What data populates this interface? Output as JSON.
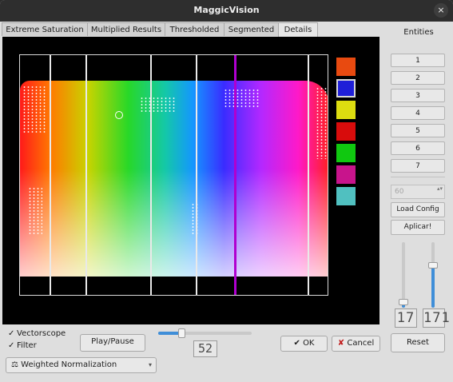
{
  "window": {
    "title": "MaggicVision",
    "close_icon": "×"
  },
  "tabs": [
    "Extreme Saturation",
    "Multiplied Results",
    "Thresholded",
    "Segmented",
    "Details"
  ],
  "active_tab": "Details",
  "sidebar": {
    "title": "Entities",
    "entities": [
      "1",
      "2",
      "3",
      "4",
      "5",
      "6",
      "7"
    ],
    "spin_value": "60",
    "load_config_label": "Load Config",
    "apply_label": "Aplicar!",
    "slider_left_value": "17",
    "slider_right_value": "171",
    "reset_label": "Reset"
  },
  "swatches": [
    "#e84a10",
    "#1f1fd8",
    "#dddd10",
    "#d80c0c",
    "#10c810",
    "#c8148c",
    "#50c0c0"
  ],
  "swatch_selected": 1,
  "bottom": {
    "vectorscope_label": "Vectorscope",
    "vectorscope_checked": true,
    "filter_label": "Filter",
    "filter_checked": true,
    "play_pause_label": "Play/Pause",
    "frame_value": "52",
    "ok_label": "OK",
    "cancel_label": "Cancel",
    "normalization_label": "Weighted Normalization"
  },
  "icons": {
    "check": "✓",
    "ok_icon": "✔",
    "cancel_icon": "✘",
    "combo_icon": "⚖",
    "combo_arrow": "▾",
    "spin_arrows": "▴▾"
  }
}
